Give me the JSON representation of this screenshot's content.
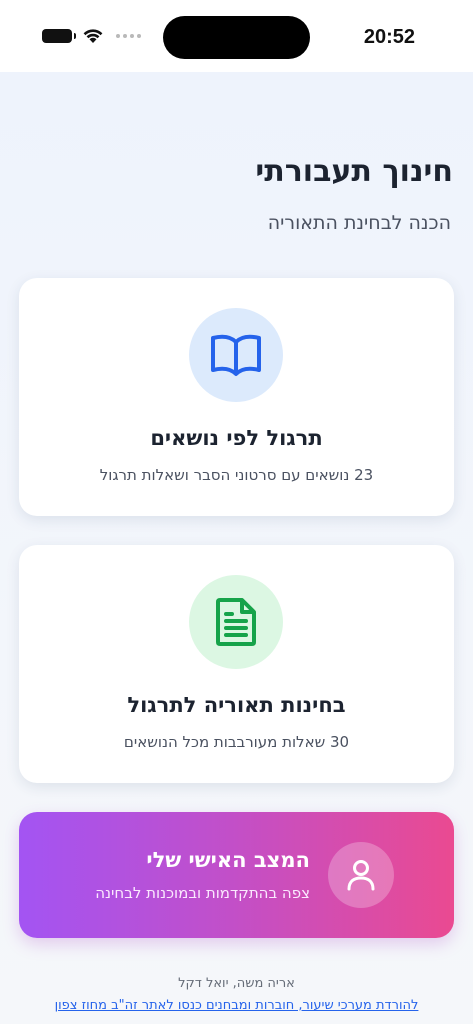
{
  "status_bar": {
    "time": "20:52",
    "icons": [
      "battery-icon",
      "wifi-icon",
      "cellular-dots-icon"
    ]
  },
  "header": {
    "title": "חינוך תעבורתי",
    "subtitle": "הכנה לבחינת התאוריה"
  },
  "cards": [
    {
      "icon": "open-book-icon",
      "icon_color": "#2563eb",
      "icon_bg": "#dceafc",
      "title": "תרגול לפי נושאים",
      "subtitle": "23 נושאים עם סרטוני הסבר ושאלות תרגול"
    },
    {
      "icon": "document-icon",
      "icon_color": "#16a34a",
      "icon_bg": "#dcf7e3",
      "title": "בחינות תאוריה לתרגול",
      "subtitle": "30 שאלות מעורבבות מכל הנושאים"
    }
  ],
  "banner": {
    "icon": "user-icon",
    "title": "המצב האישי שלי",
    "subtitle": "צפה בהתקדמות ובמוכנות לבחינה",
    "gradient": [
      "#a354f3",
      "#ea4a91"
    ]
  },
  "footer": {
    "names": "אריה משה, יואל דקל",
    "link_text": "להורדת מערכי שיעור, חוברות ומבחנים כנסו לאתר זה\"ב מחוז צפון"
  }
}
